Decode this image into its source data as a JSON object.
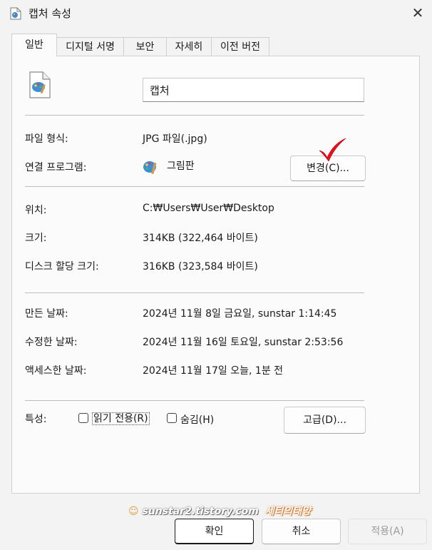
{
  "window": {
    "title": "캡처 속성",
    "close_glyph": "✕"
  },
  "tabs": [
    {
      "label": "일반",
      "active": true
    },
    {
      "label": "디지털 서명"
    },
    {
      "label": "보안"
    },
    {
      "label": "자세히"
    },
    {
      "label": "이전 버전"
    }
  ],
  "file": {
    "name": "캡처",
    "icon": "paint-file-icon"
  },
  "rows": {
    "type_label": "파일 형식:",
    "type_value": "JPG 파일(.jpg)",
    "opens_label": "연결 프로그램:",
    "opens_value": "그림판",
    "opens_icon": "paint-app-icon",
    "change_button": "변경(C)...",
    "location_label": "위치:",
    "location_value": "C:₩Users₩User₩Desktop",
    "size_label": "크기:",
    "size_value": "314KB (322,464 바이트)",
    "size_on_disk_label": "디스크 할당 크기:",
    "size_on_disk_value": "316KB (323,584 바이트)",
    "created_label": "만든 날짜:",
    "created_value": "2024년 11월 8일 금요일, sunstar 1:14:45",
    "modified_label": "수정한 날짜:",
    "modified_value": "2024년 11월 16일 토요일, sunstar 2:53:56",
    "accessed_label": "액세스한 날짜:",
    "accessed_value": "2024년 11월 17일 오늘, 1분 전"
  },
  "attributes": {
    "label": "특성:",
    "readonly": "읽기 전용(R)",
    "hidden": "숨김(H)",
    "advanced_button": "고급(D)..."
  },
  "footer": {
    "ok": "확인",
    "cancel": "취소",
    "apply": "적용(A)"
  },
  "watermark": {
    "url": "sunstar2.tistory.com",
    "brand": "세티의태양"
  },
  "colors": {
    "accent_check": "#e8101a",
    "window_bg": "#f3f3f3",
    "panel_bg": "#fbfbfb"
  }
}
